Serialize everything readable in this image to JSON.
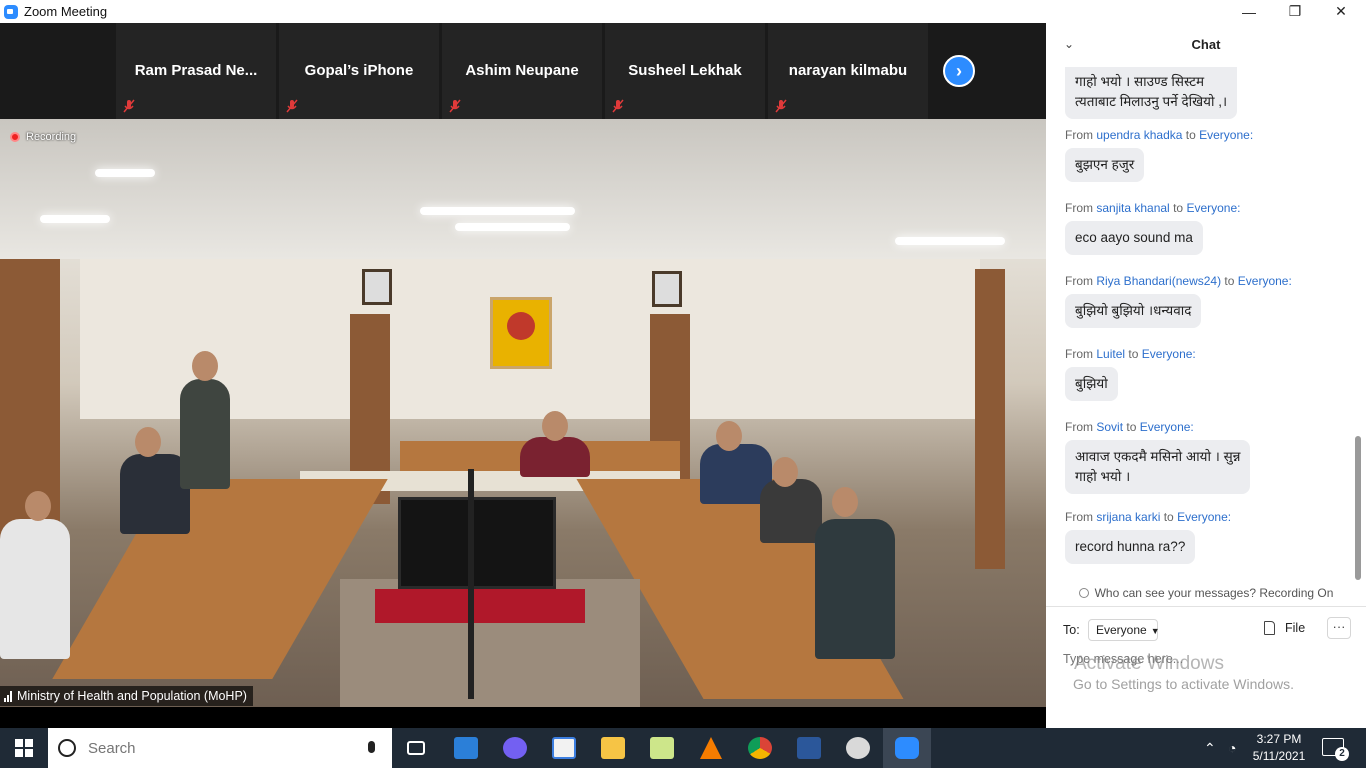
{
  "window": {
    "title": "Zoom Meeting"
  },
  "participants": [
    {
      "name": "Ram  Prasad Ne..."
    },
    {
      "name": "Gopal’s iPhone"
    },
    {
      "name": "Ashim Neupane"
    },
    {
      "name": "Susheel Lekhak"
    },
    {
      "name": "narayan kilmabu"
    }
  ],
  "video": {
    "recording_label": "Recording",
    "speaker_label": "Ministry of Health and Population (MoHP)"
  },
  "chat": {
    "title": "Chat",
    "messages": [
      {
        "sender": "",
        "to": "",
        "text": "गाहो भयो । साउण्ड सिस्टम\nत्यताबाट मिलाउनु पर्ने देखियो ,।"
      },
      {
        "sender": "upendra khadka",
        "to": "Everyone:",
        "text": "बुझएन हजुर"
      },
      {
        "sender": "sanjita khanal",
        "to": "Everyone:",
        "text": "eco aayo sound  ma"
      },
      {
        "sender": "Riya Bhandari(news24)",
        "to": "Everyone:",
        "text": "बुझियो बुझियो ।धन्यवाद"
      },
      {
        "sender": "Luitel",
        "to": "Everyone:",
        "text": "बुझियो"
      },
      {
        "sender": "Sovit",
        "to": "Everyone:",
        "text": "आवाज एकदमै मसिनो आयो । सुन्न\nगाहो भयो ।"
      },
      {
        "sender": "srijana karki",
        "to": "Everyone:",
        "text": "record hunna ra??"
      }
    ],
    "from_word": "From",
    "to_word": "to",
    "who_sees": "Who can see your messages? Recording On",
    "to_label": "To:",
    "to_value": "Everyone",
    "file_label": "File",
    "more_label": "···",
    "input_placeholder": "Type message here...",
    "watermark_line1": "Activate Windows",
    "watermark_line2": "Go to Settings to activate Windows."
  },
  "taskbar": {
    "search_placeholder": "Search",
    "time": "3:27 PM",
    "date": "5/11/2021",
    "notification_count": "2",
    "apps": [
      "task-view-icon",
      "mail-icon",
      "viber-icon",
      "store-icon",
      "file-explorer-icon",
      "notepad-icon",
      "vlc-icon",
      "chrome-icon",
      "word-icon",
      "paint-icon",
      "zoom-icon"
    ]
  },
  "colors": {
    "accent": "#2d8cff",
    "chat_link": "#2d6fcc",
    "taskbar": "#1f2a36"
  }
}
